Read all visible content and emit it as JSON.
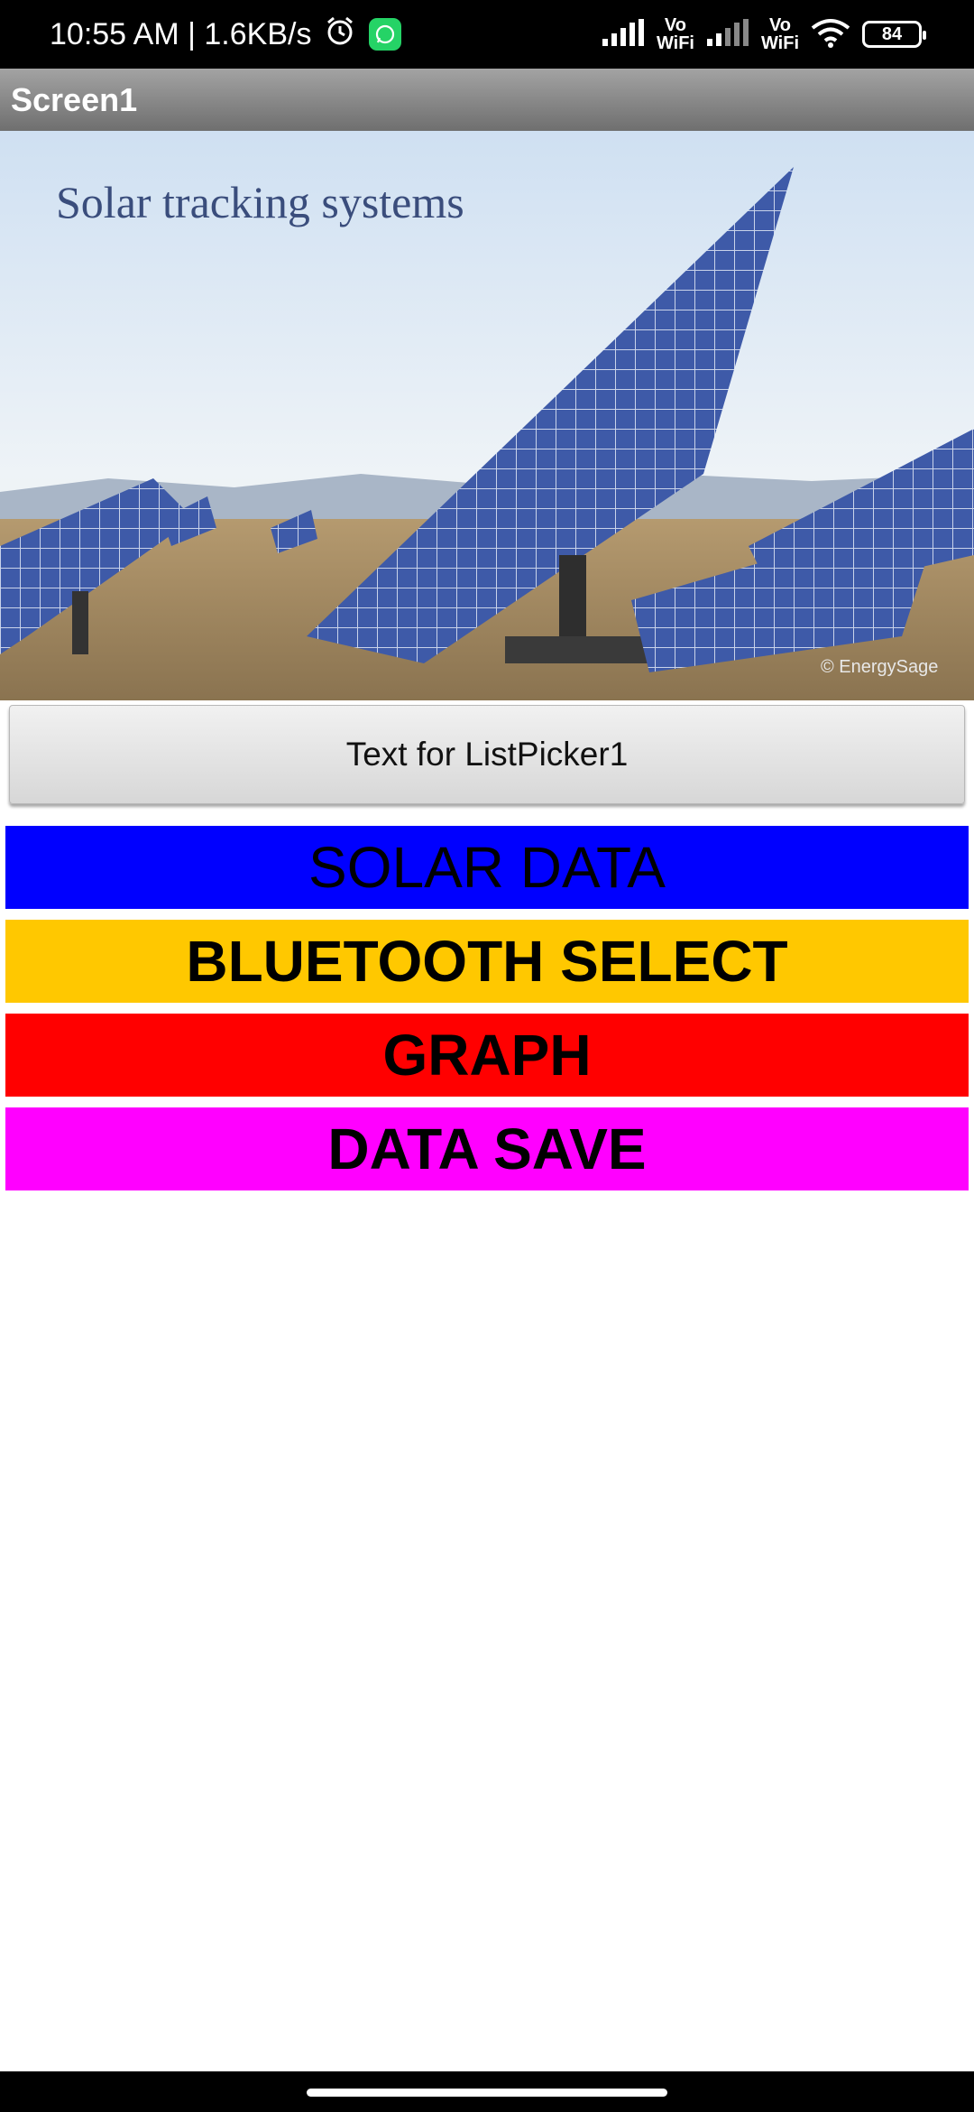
{
  "status_bar": {
    "time_speed": "10:55 AM | 1.6KB/s",
    "vowifi_1": "Vo\nWiFi",
    "vowifi_2": "Vo\nWiFi",
    "battery": "84"
  },
  "app": {
    "title": "Screen1"
  },
  "hero": {
    "caption": "Solar tracking systems",
    "watermark": "© EnergySage"
  },
  "listpicker": {
    "label": "Text for ListPicker1"
  },
  "buttons": {
    "solar_data": "SOLAR DATA",
    "bluetooth_select": "BLUETOOTH SELECT",
    "graph": "GRAPH",
    "data_save": "DATA SAVE"
  },
  "colors": {
    "solar_data": "#0000ff",
    "bluetooth_select": "#ffc800",
    "graph": "#ff0000",
    "data_save": "#ff00ff"
  }
}
